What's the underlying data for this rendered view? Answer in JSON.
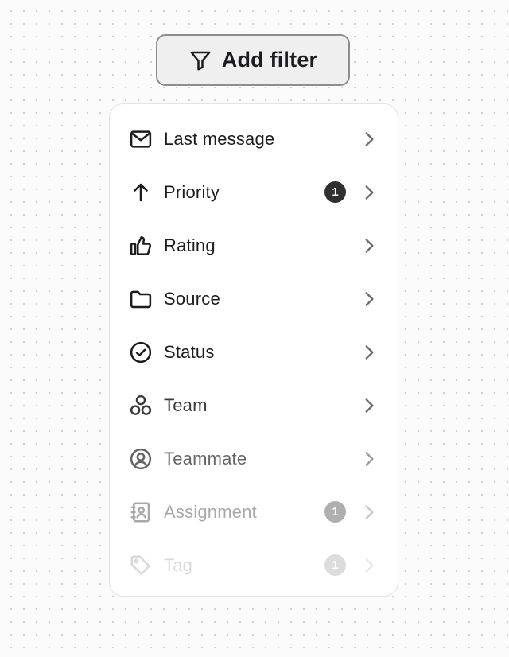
{
  "add_filter": {
    "label": "Add filter",
    "icon": "filter-icon"
  },
  "menu": {
    "items": [
      {
        "label": "Last message",
        "icon": "mail-icon",
        "badge": ""
      },
      {
        "label": "Priority",
        "icon": "arrow-up-icon",
        "badge": "1"
      },
      {
        "label": "Rating",
        "icon": "thumbs-up-icon",
        "badge": ""
      },
      {
        "label": "Source",
        "icon": "folder-icon",
        "badge": ""
      },
      {
        "label": "Status",
        "icon": "check-circle-icon",
        "badge": ""
      },
      {
        "label": "Team",
        "icon": "team-icon",
        "badge": ""
      },
      {
        "label": "Teammate",
        "icon": "user-circle-icon",
        "badge": ""
      },
      {
        "label": "Assignment",
        "icon": "contact-book-icon",
        "badge": "1"
      },
      {
        "label": "Tag",
        "icon": "tag-icon",
        "badge": "1"
      }
    ]
  },
  "colors": {
    "text": "#1c1c1e",
    "badge": "#2f2f34",
    "chevron": "#6b6b6b"
  }
}
